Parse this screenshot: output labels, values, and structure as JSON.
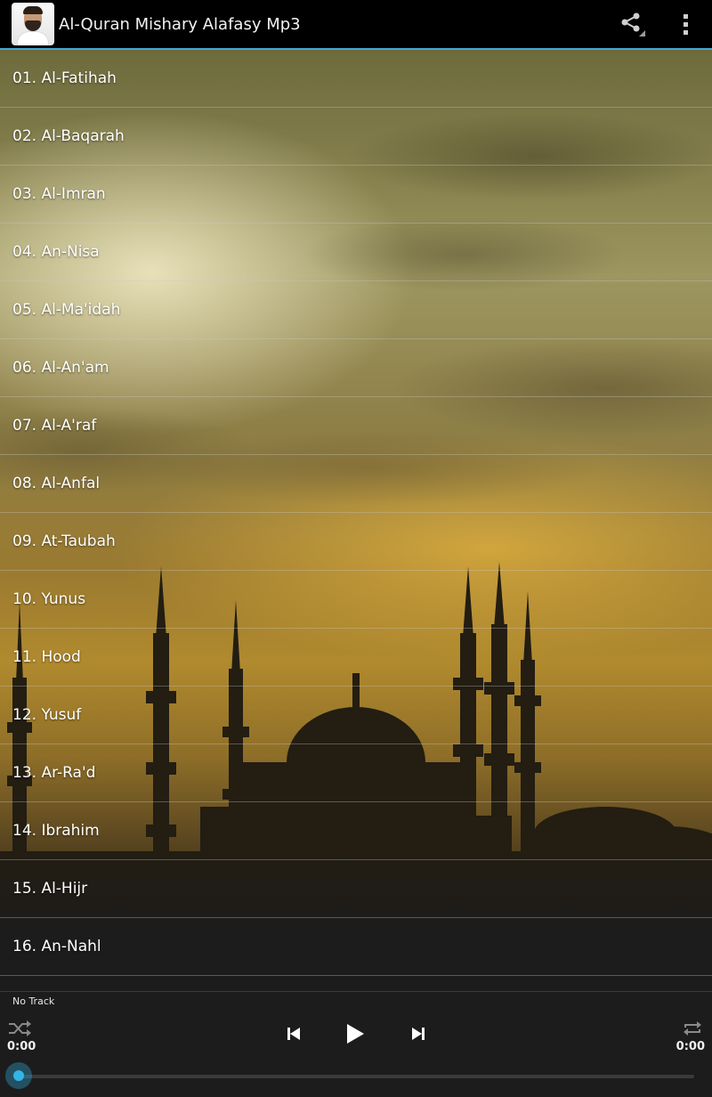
{
  "app": {
    "title": "Al-Quran Mishary Alafasy Mp3",
    "icon": "reciter-avatar-icon"
  },
  "action_bar": {
    "share_icon": "share-icon",
    "overflow_icon": "overflow-menu-icon"
  },
  "tracks": [
    {
      "label": "01. Al-Fatihah"
    },
    {
      "label": "02. Al-Baqarah"
    },
    {
      "label": "03. Al-Imran"
    },
    {
      "label": "04. An-Nisa"
    },
    {
      "label": "05. Al-Ma'idah"
    },
    {
      "label": "06. Al-An'am"
    },
    {
      "label": "07. Al-A'raf"
    },
    {
      "label": "08. Al-Anfal"
    },
    {
      "label": "09. At-Taubah"
    },
    {
      "label": "10. Yunus"
    },
    {
      "label": "11. Hood"
    },
    {
      "label": "12. Yusuf"
    },
    {
      "label": "13. Ar-Ra'd"
    },
    {
      "label": "14. Ibrahim"
    },
    {
      "label": "15. Al-Hijr"
    },
    {
      "label": "16. An-Nahl"
    }
  ],
  "player": {
    "now_playing": "No Track",
    "elapsed": "0:00",
    "duration": "0:00",
    "progress": 0,
    "icons": {
      "shuffle": "shuffle-icon",
      "previous": "skip-previous-icon",
      "play": "play-icon",
      "next": "skip-next-icon",
      "repeat": "repeat-icon"
    }
  },
  "colors": {
    "accent": "#33b5e5",
    "action_bar": "#000000",
    "player_bg": "#1c1c1c"
  }
}
